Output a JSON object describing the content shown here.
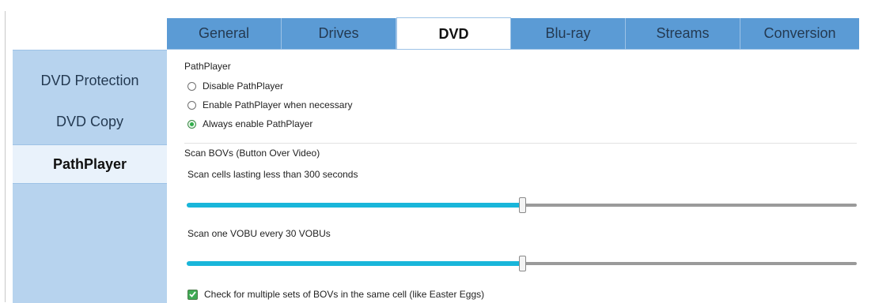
{
  "tabs": [
    "General",
    "Drives",
    "DVD",
    "Blu-ray",
    "Streams",
    "Conversion"
  ],
  "active_tab": "DVD",
  "sidebar": {
    "items": [
      {
        "label": "DVD Protection"
      },
      {
        "label": "DVD Copy"
      },
      {
        "label": "PathPlayer"
      }
    ],
    "active": "PathPlayer"
  },
  "pathplayer": {
    "section_title": "PathPlayer",
    "options": [
      {
        "label": "Disable PathPlayer",
        "checked": false
      },
      {
        "label": "Enable PathPlayer when necessary",
        "checked": false
      },
      {
        "label": "Always enable PathPlayer",
        "checked": true
      }
    ]
  },
  "bov": {
    "section_title": "Scan BOVs (Button Over Video)",
    "scan_cells_label": "Scan cells lasting less than 300 seconds",
    "scan_cells_level": 0.5,
    "scan_vobu_label": "Scan one VOBU every 30 VOBUs",
    "scan_vobu_level": 0.5,
    "multiple_sets_label": "Check for multiple sets of BOVs in the same cell (like Easter Eggs)",
    "multiple_sets_checked": true
  },
  "colors": {
    "tab_bg": "#5b9bd5",
    "sidebar_bg": "#b7d3ee",
    "slider_fill": "#19b6da",
    "radio_checked": "#2fae4a"
  }
}
